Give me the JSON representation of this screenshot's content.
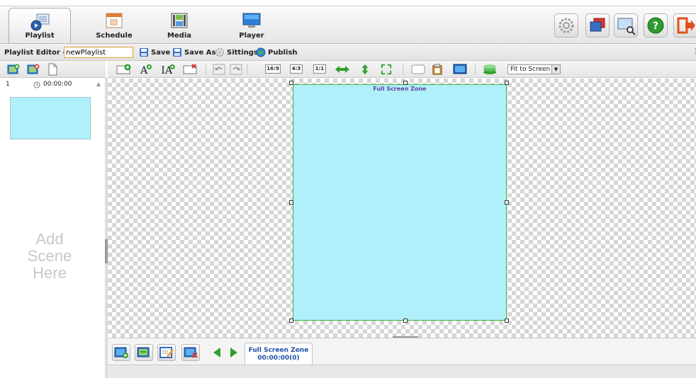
{
  "nav": {
    "tabs": [
      {
        "label": "Playlist",
        "icon": "playlist-icon",
        "active": true
      },
      {
        "label": "Schedule",
        "icon": "calendar-icon",
        "active": false
      },
      {
        "label": "Media",
        "icon": "film-icon",
        "active": false
      },
      {
        "label": "Player",
        "icon": "monitor-icon",
        "active": false
      }
    ],
    "tools": [
      "settings-gear-icon",
      "display-icon",
      "screen-search-icon",
      "help-icon",
      "logout-icon"
    ]
  },
  "editor": {
    "label": "Playlist Editor - ",
    "name_value": "newPlaylist",
    "save": "Save",
    "save_as": "Save As",
    "sittings": "Sittings",
    "publish": "Publish"
  },
  "scenes": {
    "items": [
      {
        "index": "1",
        "time": "00:00:00"
      }
    ],
    "add_hint_line1": "Add",
    "add_hint_line2": "Scene",
    "add_hint_line3": "Here"
  },
  "toolbar": {
    "ratio_169": "16:9",
    "ratio_43": "4:3",
    "ratio_11": "1:1",
    "zoom_value": "Fit to Screen"
  },
  "zone": {
    "label": "Full Screen Zone"
  },
  "timeline": {
    "tab_name": "Full Screen Zone",
    "tab_time": "00:00:00(0)"
  },
  "colors": {
    "zone_fill": "#aff0fb",
    "zone_border": "#39b739",
    "zone_label": "#6b3fa0",
    "timeline_text": "#1f4fa8"
  }
}
